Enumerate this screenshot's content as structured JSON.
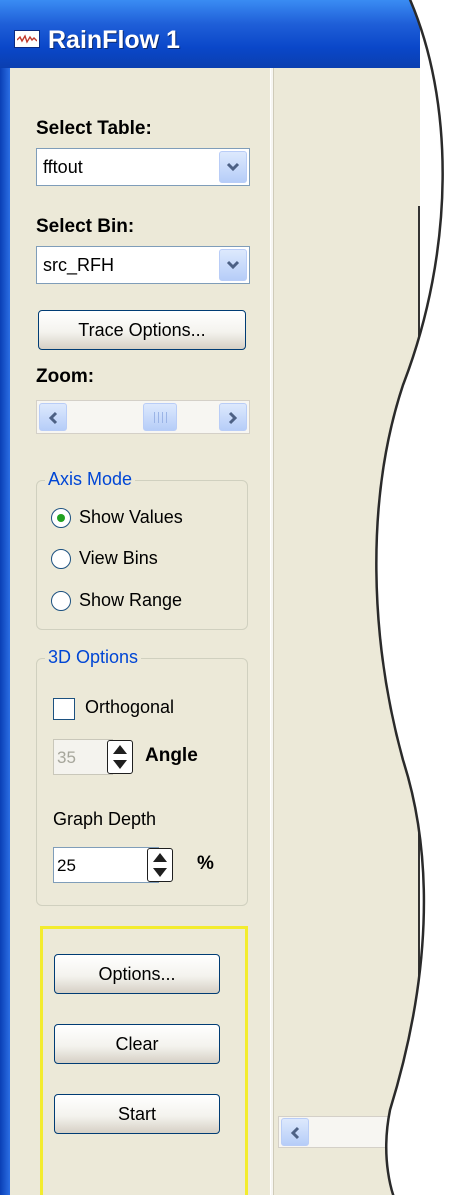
{
  "window": {
    "title": "RainFlow 1"
  },
  "panel": {
    "select_table": {
      "label": "Select Table:",
      "value": "fftout"
    },
    "select_bin": {
      "label": "Select Bin:",
      "value": "src_RFH"
    },
    "trace_options_label": "Trace Options...",
    "zoom": {
      "label": "Zoom:"
    },
    "axis_mode": {
      "title": "Axis Mode",
      "options": [
        "Show Values",
        "View Bins",
        "Show Range"
      ],
      "selected": "Show Values"
    },
    "options_3d": {
      "title": "3D Options",
      "orthogonal_label": "Orthogonal",
      "orthogonal_checked": false,
      "angle_value": "35",
      "angle_label": "Angle",
      "graph_depth_label": "Graph Depth",
      "graph_depth_value": "25",
      "percent_label": "%"
    },
    "buttons": {
      "options": "Options...",
      "clear": "Clear",
      "start": "Start"
    }
  },
  "colors": {
    "title_bar": "#0a47c9",
    "group_title": "#0046d5",
    "highlight": "#f3ec2e",
    "radio_selected": "#21a121"
  },
  "icons": [
    "app-icon",
    "chevron-down-icon",
    "chevron-left-icon",
    "chevron-right-icon",
    "spin-up-icon",
    "spin-down-icon"
  ]
}
